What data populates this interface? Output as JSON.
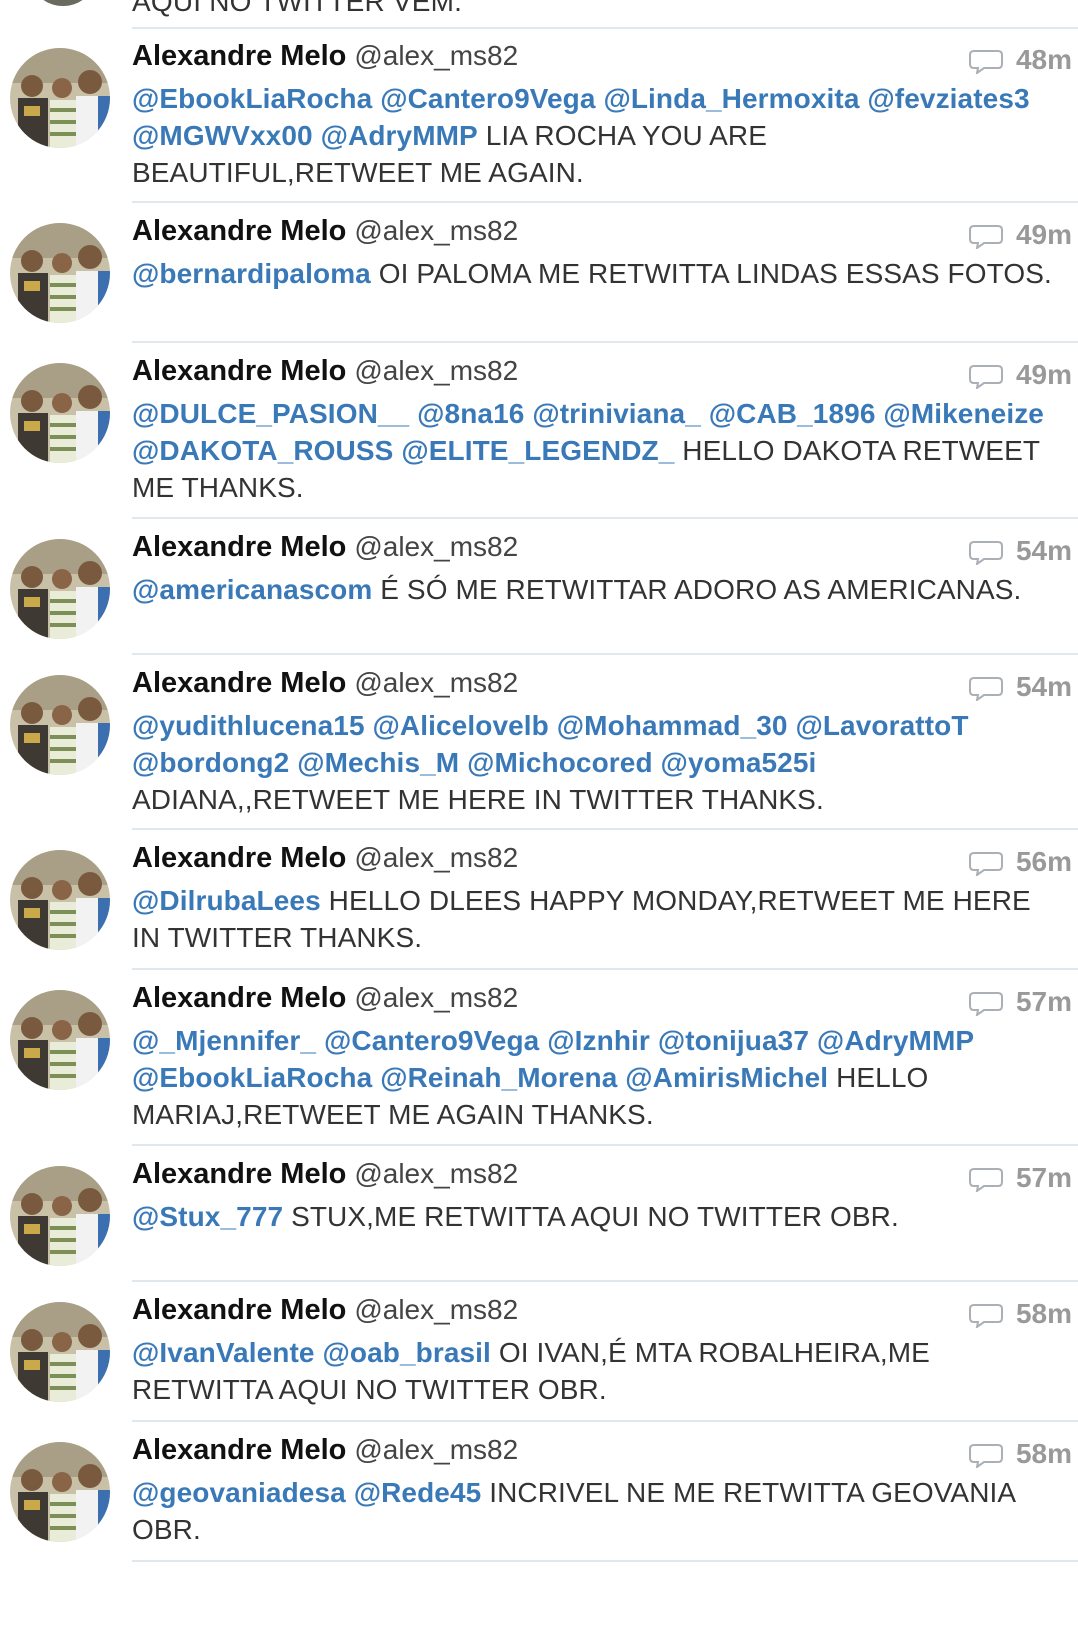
{
  "top_partial_text": "AQUI NO TWITTER VEM.",
  "tweets": [
    {
      "name": "Alexandre Melo",
      "handle": "@alex_ms82",
      "time": "48m",
      "mentions": [
        "@EbookLiaRocha",
        "@Cantero9Vega",
        "@Linda_Hermoxita",
        "@fevziates3",
        "@MGWVxx00",
        "@AdryMMP"
      ],
      "text": "LIA ROCHA YOU ARE BEAUTIFUL,RETWEET ME AGAIN."
    },
    {
      "name": "Alexandre Melo",
      "handle": "@alex_ms82",
      "time": "49m",
      "mentions": [
        "@bernardipaloma"
      ],
      "text": "OI PALOMA ME RETWITTA LINDAS ESSAS FOTOS."
    },
    {
      "name": "Alexandre Melo",
      "handle": "@alex_ms82",
      "time": "49m",
      "mentions": [
        "@DULCE_PASION__",
        "@8na16",
        "@triniviana_",
        "@CAB_1896",
        "@Mikeneize",
        "@DAKOTA_ROUSS",
        "@ELITE_LEGENDZ_"
      ],
      "text": "HELLO DAKOTA RETWEET ME THANKS."
    },
    {
      "name": "Alexandre Melo",
      "handle": "@alex_ms82",
      "time": "54m",
      "mentions": [
        "@americanascom"
      ],
      "text": "É SÓ ME RETWITTAR ADORO AS AMERICANAS."
    },
    {
      "name": "Alexandre Melo",
      "handle": "@alex_ms82",
      "time": "54m",
      "mentions": [
        "@yudithlucena15",
        "@Alicelovelb",
        "@Mohammad_30",
        "@LavorattoT",
        "@bordong2",
        "@Mechis_M",
        "@Michocored",
        "@yoma525i"
      ],
      "text": "ADIANA,,RETWEET ME HERE IN TWITTER THANKS."
    },
    {
      "name": "Alexandre Melo",
      "handle": "@alex_ms82",
      "time": "56m",
      "mentions": [
        "@DilrubaLees"
      ],
      "text": "HELLO DLEES HAPPY MONDAY,RETWEET ME HERE IN TWITTER THANKS."
    },
    {
      "name": "Alexandre Melo",
      "handle": "@alex_ms82",
      "time": "57m",
      "mentions": [
        "@_Mjennifer_",
        "@Cantero9Vega",
        "@Iznhir",
        "@tonijua37",
        "@AdryMMP",
        "@EbookLiaRocha",
        "@Reinah_Morena",
        "@AmirisMichel"
      ],
      "text": "HELLO MARIAJ,RETWEET ME AGAIN THANKS."
    },
    {
      "name": "Alexandre Melo",
      "handle": "@alex_ms82",
      "time": "57m",
      "mentions": [
        "@Stux_777"
      ],
      "text": "STUX,ME RETWITTA AQUI NO TWITTER OBR."
    },
    {
      "name": "Alexandre Melo",
      "handle": "@alex_ms82",
      "time": "58m",
      "mentions": [
        "@IvanValente",
        "@oab_brasil"
      ],
      "text": "OI IVAN,É MTA ROBALHEIRA,ME RETWITTA AQUI NO TWITTER OBR."
    },
    {
      "name": "Alexandre Melo",
      "handle": "@alex_ms82",
      "time": "58m",
      "mentions": [
        "@geovaniadesa",
        "@Rede45"
      ],
      "text": "INCRIVEL NE ME RETWITTA GEOVANIA OBR."
    }
  ],
  "colors": {
    "mention": "#3a79b8",
    "name": "#111111",
    "text": "#333333",
    "time": "#999999",
    "divider": "#e1e8ed"
  },
  "icons": {
    "reply": "reply-icon",
    "avatar": "avatar"
  }
}
